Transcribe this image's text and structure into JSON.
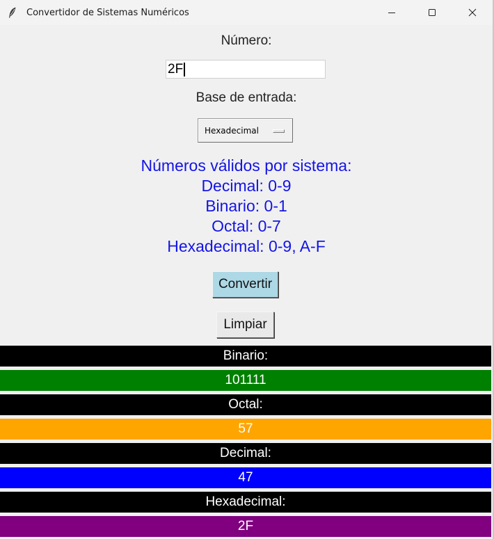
{
  "window": {
    "title": "Convertidor de Sistemas Numéricos",
    "app_icon": "feather-icon",
    "controls": [
      "minimize-icon",
      "maximize-icon",
      "close-icon"
    ]
  },
  "form": {
    "number_label": "Número:",
    "number_value": "2F",
    "base_label": "Base de entrada:",
    "base_selected": "Hexadecimal"
  },
  "info": {
    "heading": "Números válidos por sistema:",
    "lines": [
      "Decimal: 0-9",
      "Binario: 0-1",
      "Octal: 0-7",
      "Hexadecimal: 0-9, A-F"
    ],
    "color": "#1414e6"
  },
  "buttons": {
    "convert": "Convertir",
    "convert_bg": "#add8e6",
    "clear": "Limpiar"
  },
  "results": [
    {
      "label": "Binario:",
      "value": "101111",
      "color": "#008000"
    },
    {
      "label": "Octal:",
      "value": "57",
      "color": "#ffa500"
    },
    {
      "label": "Decimal:",
      "value": "47",
      "color": "#0000ff"
    },
    {
      "label": "Hexadecimal:",
      "value": "2F",
      "color": "#800080"
    }
  ]
}
